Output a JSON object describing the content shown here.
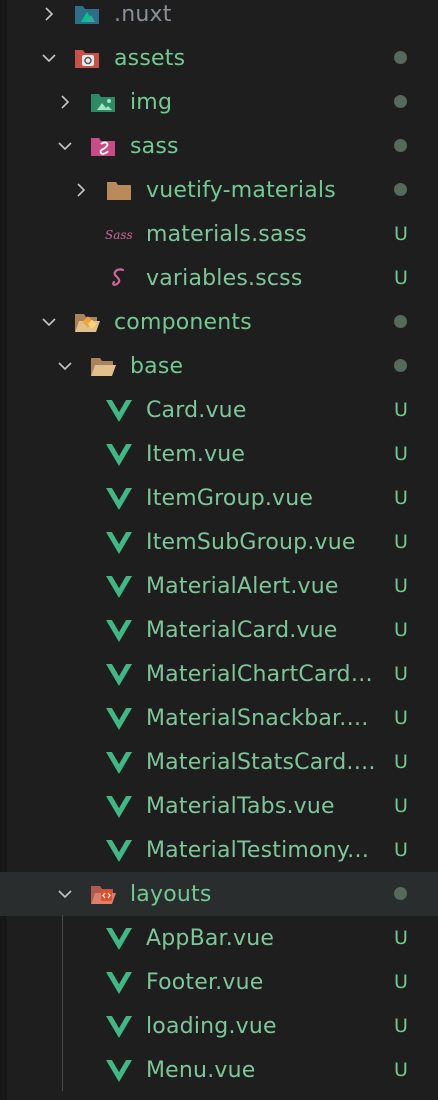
{
  "explorer": {
    "items": [
      {
        "name": ".nuxt",
        "type": "folder",
        "expanded": false,
        "depth": 0,
        "status": "",
        "icon": "nuxt-folder-icon"
      },
      {
        "name": "assets",
        "type": "folder",
        "expanded": true,
        "depth": 0,
        "status": "dot",
        "icon": "assets-folder-icon"
      },
      {
        "name": "img",
        "type": "folder",
        "expanded": false,
        "depth": 1,
        "status": "dot",
        "icon": "image-folder-icon"
      },
      {
        "name": "sass",
        "type": "folder",
        "expanded": true,
        "depth": 1,
        "status": "dot",
        "icon": "sass-folder-icon"
      },
      {
        "name": "vuetify-materials",
        "type": "folder",
        "expanded": false,
        "depth": 2,
        "status": "dot",
        "icon": "folder-icon"
      },
      {
        "name": "materials.sass",
        "type": "file",
        "depth": 2,
        "status": "U",
        "icon": "sass-file-icon"
      },
      {
        "name": "variables.scss",
        "type": "file",
        "depth": 2,
        "status": "U",
        "icon": "scss-file-icon"
      },
      {
        "name": "components",
        "type": "folder",
        "expanded": true,
        "depth": 0,
        "status": "dot",
        "icon": "components-folder-icon"
      },
      {
        "name": "base",
        "type": "folder",
        "expanded": true,
        "depth": 1,
        "status": "dot",
        "icon": "open-folder-icon"
      },
      {
        "name": "Card.vue",
        "type": "file",
        "depth": 2,
        "status": "U",
        "icon": "vue-file-icon"
      },
      {
        "name": "Item.vue",
        "type": "file",
        "depth": 2,
        "status": "U",
        "icon": "vue-file-icon"
      },
      {
        "name": "ItemGroup.vue",
        "type": "file",
        "depth": 2,
        "status": "U",
        "icon": "vue-file-icon"
      },
      {
        "name": "ItemSubGroup.vue",
        "type": "file",
        "depth": 2,
        "status": "U",
        "icon": "vue-file-icon"
      },
      {
        "name": "MaterialAlert.vue",
        "type": "file",
        "depth": 2,
        "status": "U",
        "icon": "vue-file-icon"
      },
      {
        "name": "MaterialCard.vue",
        "type": "file",
        "depth": 2,
        "status": "U",
        "icon": "vue-file-icon"
      },
      {
        "name": "MaterialChartCard.vue",
        "type": "file",
        "depth": 2,
        "status": "U",
        "icon": "vue-file-icon"
      },
      {
        "name": "MaterialSnackbar.vue",
        "type": "file",
        "depth": 2,
        "status": "U",
        "icon": "vue-file-icon"
      },
      {
        "name": "MaterialStatsCard.vue",
        "type": "file",
        "depth": 2,
        "status": "U",
        "icon": "vue-file-icon"
      },
      {
        "name": "MaterialTabs.vue",
        "type": "file",
        "depth": 2,
        "status": "U",
        "icon": "vue-file-icon"
      },
      {
        "name": "MaterialTestimony.vue",
        "type": "file",
        "depth": 2,
        "status": "U",
        "icon": "vue-file-icon"
      },
      {
        "name": "layouts",
        "type": "folder",
        "expanded": true,
        "depth": 1,
        "status": "dot",
        "icon": "layouts-folder-icon",
        "selected": true
      },
      {
        "name": "AppBar.vue",
        "type": "file",
        "depth": 2,
        "status": "U",
        "icon": "vue-file-icon"
      },
      {
        "name": "Footer.vue",
        "type": "file",
        "depth": 2,
        "status": "U",
        "icon": "vue-file-icon"
      },
      {
        "name": "loading.vue",
        "type": "file",
        "depth": 2,
        "status": "U",
        "icon": "vue-file-icon"
      },
      {
        "name": "Menu.vue",
        "type": "file",
        "depth": 2,
        "status": "U",
        "icon": "vue-file-icon"
      }
    ]
  },
  "colors": {
    "background": "#1e1e1e",
    "untracked_text": "#73c991",
    "selected_row": "#2a2d2e",
    "vue_green": "#41b883"
  }
}
